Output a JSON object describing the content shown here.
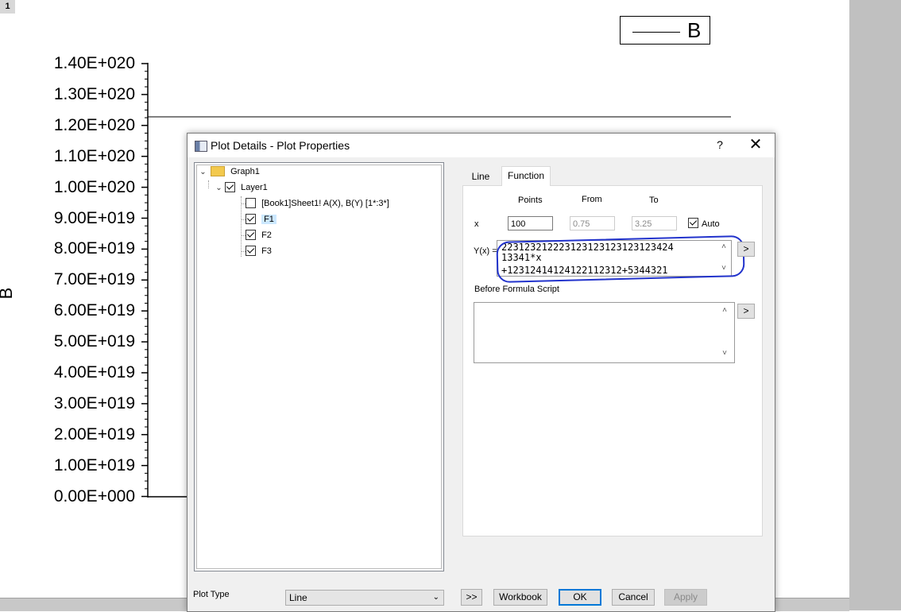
{
  "graph": {
    "layer_badge": "1",
    "y_axis_title": "B",
    "y_ticks": [
      "1.40E+020",
      "1.30E+020",
      "1.20E+020",
      "1.10E+020",
      "1.00E+020",
      "9.00E+019",
      "8.00E+019",
      "7.00E+019",
      "6.00E+019",
      "5.00E+019",
      "4.00E+019",
      "3.00E+019",
      "2.00E+019",
      "1.00E+019",
      "0.00E+000"
    ],
    "legend_label": "B"
  },
  "dialog": {
    "title": "Plot Details - Plot Properties",
    "help_label": "?",
    "close_label": "✕",
    "tree": {
      "graph": "Graph1",
      "layer": "Layer1",
      "items": [
        {
          "label": "[Book1]Sheet1! A(X), B(Y) [1*:3*]",
          "checked": false
        },
        {
          "label": "F1",
          "checked": true,
          "selected": true
        },
        {
          "label": "F2",
          "checked": true
        },
        {
          "label": "F3",
          "checked": true
        }
      ]
    },
    "tabs": [
      "Line",
      "Function"
    ],
    "active_tab": "Function",
    "function_tab": {
      "points_header": "Points",
      "from_header": "From",
      "to_header": "To",
      "x_label": "x",
      "points_value": "100",
      "from_value": "0.75",
      "to_value": "3.25",
      "auto_label": "Auto",
      "auto_checked": true,
      "yx_label": "Y(x) =",
      "yx_line1": "2231232122231231231231231234 24",
      "yx_line1_exact": "22312321222312312312312312342 4",
      "yx_text_line1": "223123212223123123123123123424",
      "yx_text_line2": "13341*x",
      "yx_text_line3": "+12312414124122112312+5344321",
      "expand_button": ">",
      "before_script_label": "Before Formula Script",
      "script_expand_button": ">"
    },
    "footer": {
      "plot_type_label": "Plot Type",
      "plot_type_value": "Line",
      "more_button": ">>",
      "workbook_button": "Workbook",
      "ok_button": "OK",
      "cancel_button": "Cancel",
      "apply_button": "Apply"
    }
  }
}
